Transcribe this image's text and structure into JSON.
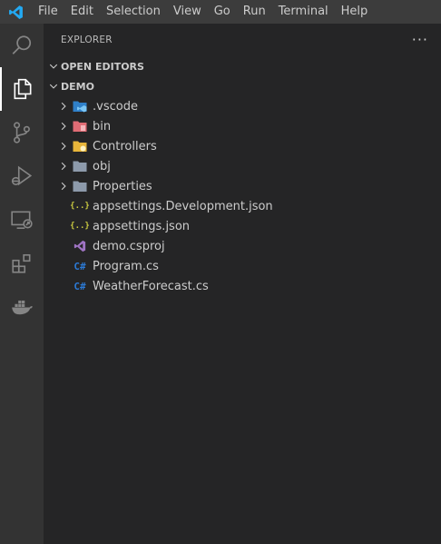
{
  "menu": [
    "File",
    "Edit",
    "Selection",
    "View",
    "Go",
    "Run",
    "Terminal",
    "Help"
  ],
  "sidebar": {
    "title": "EXPLORER",
    "more": "···",
    "open_editors": "OPEN EDITORS",
    "project": "DEMO"
  },
  "tree": [
    {
      "name": ".vscode",
      "kind": "folder",
      "icon": "vscode-folder-icon"
    },
    {
      "name": "bin",
      "kind": "folder",
      "icon": "bin-folder-icon"
    },
    {
      "name": "Controllers",
      "kind": "folder",
      "icon": "controllers-folder-icon"
    },
    {
      "name": "obj",
      "kind": "folder",
      "icon": "folder-icon"
    },
    {
      "name": "Properties",
      "kind": "folder",
      "icon": "folder-icon"
    },
    {
      "name": "appsettings.Development.json",
      "kind": "file",
      "icon": "json-icon",
      "glyph": "{..}"
    },
    {
      "name": "appsettings.json",
      "kind": "file",
      "icon": "json-icon",
      "glyph": "{..}"
    },
    {
      "name": "demo.csproj",
      "kind": "file",
      "icon": "csproj-icon"
    },
    {
      "name": "Program.cs",
      "kind": "file",
      "icon": "csharp-icon",
      "glyph": "C#"
    },
    {
      "name": "WeatherForecast.cs",
      "kind": "file",
      "icon": "csharp-icon",
      "glyph": "C#"
    }
  ],
  "colors": {
    "titlebar": "#3c3c3c",
    "activitybar": "#333333",
    "sidebar": "#252526",
    "vscode_blue": "#23a9f2",
    "json": "#cbcb41",
    "csharp": "#2c7ad6",
    "csproj": "#a074c4"
  }
}
